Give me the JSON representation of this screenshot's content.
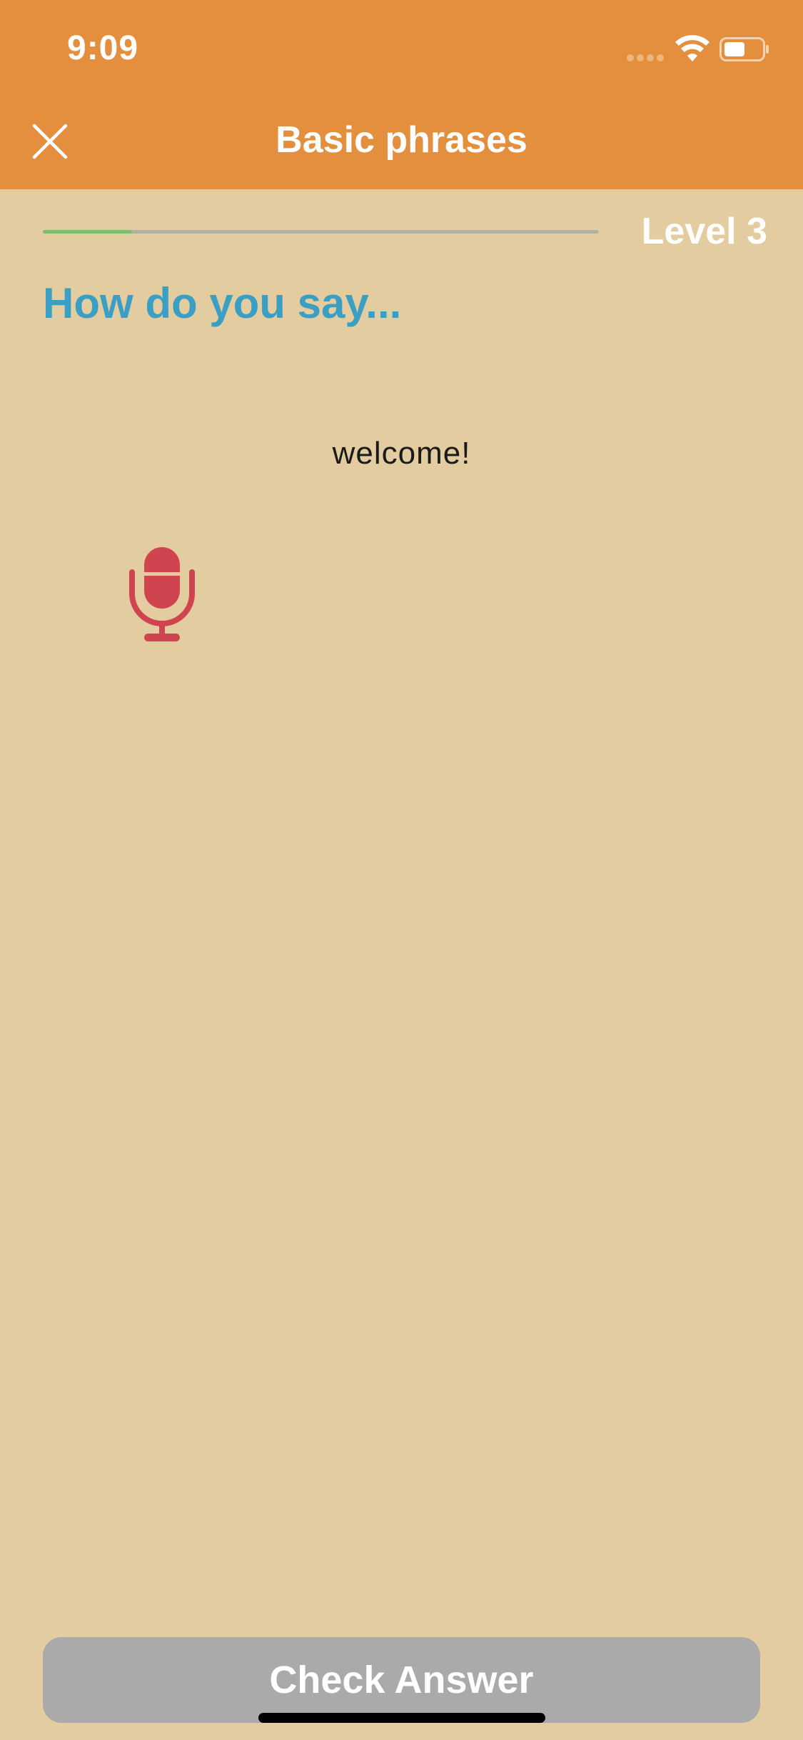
{
  "status_bar": {
    "time": "9:09"
  },
  "header": {
    "title": "Basic phrases",
    "close_icon": "close-icon"
  },
  "progress": {
    "fraction": 0.16,
    "level_label": "Level 3"
  },
  "question": {
    "heading": "How do you say...",
    "phrase": "welcome!",
    "mic_icon": "microphone-icon"
  },
  "footer": {
    "check_label": "Check Answer"
  },
  "colors": {
    "header_bg": "#e48f3d",
    "page_bg": "#e3cca0",
    "heading": "#3a9fc3",
    "progress_fill": "#7cbf6d",
    "progress_track": "#b1b1a7",
    "mic": "#d04450",
    "button_disabled": "#aaaaaa"
  }
}
